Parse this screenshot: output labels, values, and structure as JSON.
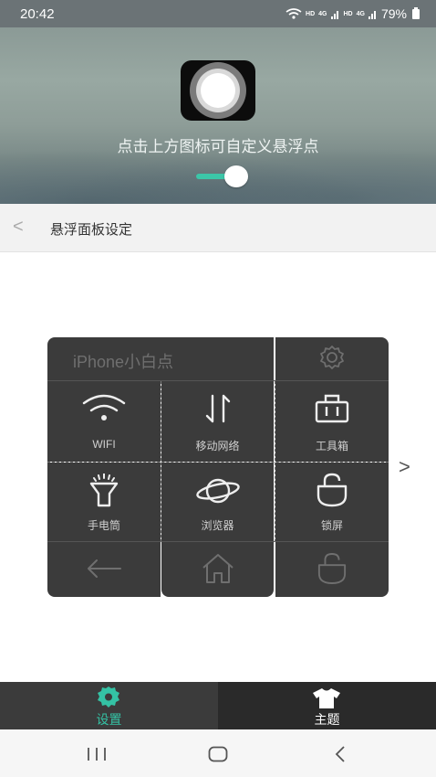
{
  "status_bar": {
    "time": "20:42",
    "net1": "HD",
    "net2": "4G",
    "net3": "HD",
    "net4": "4G",
    "battery": "79%"
  },
  "hero": {
    "hint": "点击上方图标可自定义悬浮点",
    "toggle_on": true,
    "accent": "#3cc6a8"
  },
  "header": {
    "back": "<",
    "title": "悬浮面板设定"
  },
  "panel": {
    "name": "iPhone小白点",
    "items": [
      {
        "label": "WIFI",
        "icon": "wifi-icon"
      },
      {
        "label": "移动网络",
        "icon": "mobile-data-icon"
      },
      {
        "label": "工具箱",
        "icon": "toolbox-icon"
      },
      {
        "label": "手电筒",
        "icon": "flashlight-icon"
      },
      {
        "label": "浏览器",
        "icon": "browser-icon"
      },
      {
        "label": "锁屏",
        "icon": "lock-icon"
      }
    ],
    "next": ">"
  },
  "tabs": [
    {
      "label": "设置",
      "icon": "gear-icon",
      "active": true
    },
    {
      "label": "主题",
      "icon": "tshirt-icon",
      "active": false
    }
  ]
}
